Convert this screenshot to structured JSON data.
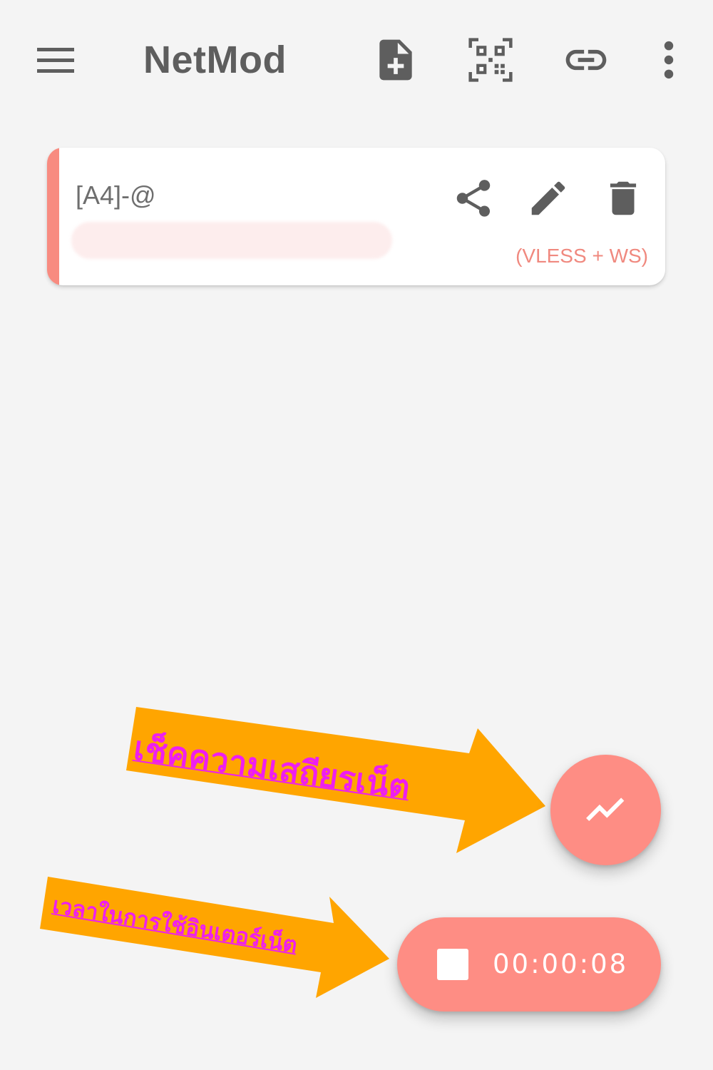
{
  "toolbar": {
    "title": "NetMod",
    "icons": [
      "menu-icon",
      "add-file-icon",
      "qr-code-scan-icon",
      "link-icon",
      "more-vert-icon"
    ]
  },
  "configs": [
    {
      "name": "[A4]-@",
      "protocol": "(VLESS + WS)",
      "actions": [
        "share-icon",
        "edit-icon",
        "delete-icon"
      ]
    }
  ],
  "fab_test": {
    "icon": "trending-up-icon"
  },
  "fab_timer": {
    "icon": "stop-icon",
    "elapsed": "00:00:08"
  },
  "annotations": {
    "speed_test_label": "เช็คความเสถียรเน็ต",
    "timer_label": "เวลาในการใช้อินเตอร์เน็ต"
  },
  "colors": {
    "background": "#f4f4f4",
    "accent": "#fe8d84",
    "icon_gray": "#5e5e5e",
    "annotation_orange": "#ffa500",
    "annotation_text": "#ee1ef0"
  }
}
